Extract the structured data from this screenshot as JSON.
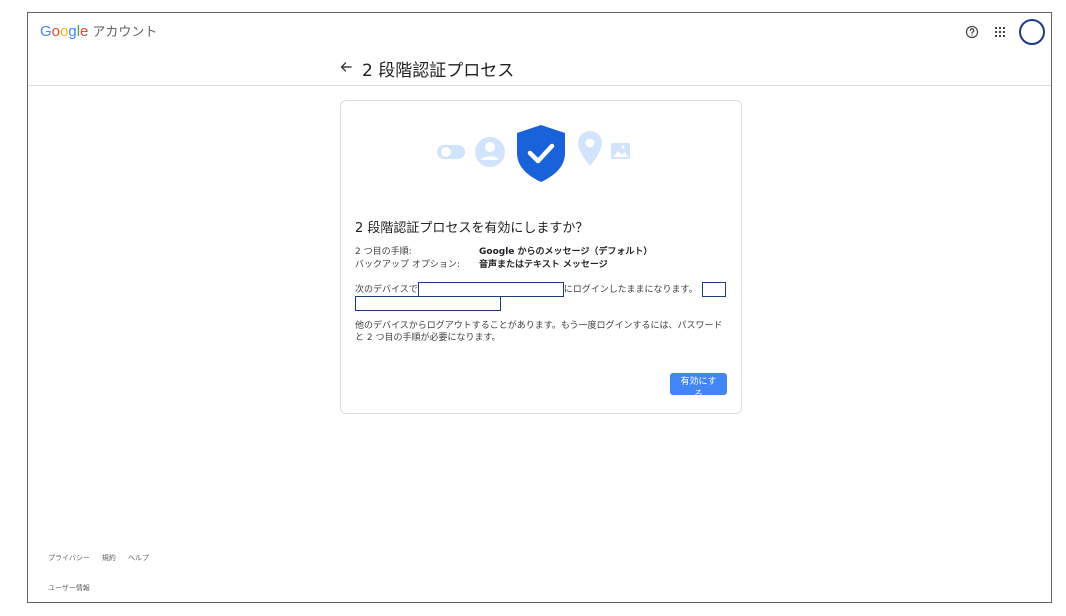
{
  "header": {
    "logo": [
      "G",
      "o",
      "o",
      "g",
      "l",
      "e"
    ],
    "product": "アカウント",
    "help_icon": "help-circle-icon",
    "apps_icon": "apps-grid-icon"
  },
  "page": {
    "title": "2 段階認証プロセス"
  },
  "card": {
    "title": "2 段階認証プロセスを有効にしますか？",
    "rows": [
      {
        "label": "2 つ目の手順:",
        "value": "Google からのメッセージ（デフォルト）"
      },
      {
        "label": "バックアップ オプション:",
        "value": "音声またはテキスト メッセージ"
      }
    ],
    "device_prefix": "次のデバイスで",
    "device_suffix": "にログインしたままになります。",
    "note": "他のデバイスからログアウトすることがあります。もう一度ログインするには、パスワードと 2 つ目の手順が必要になります。",
    "enable_button": "有効にする"
  },
  "footer": {
    "links": [
      "プライバシー",
      "規約",
      "ヘルプ"
    ],
    "user_info": "ユーザー情報"
  },
  "colors": {
    "shield": "#1a62d9",
    "illustration_light": "#d2e3fc",
    "button": "#4285f4",
    "redaction_border": "#1f3a78"
  }
}
